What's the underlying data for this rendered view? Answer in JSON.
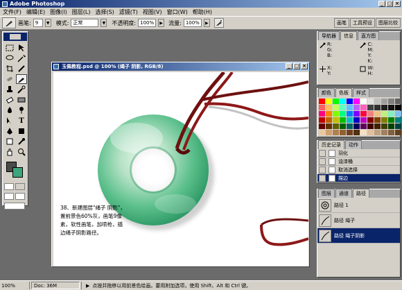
{
  "app": {
    "title": "Adobe Photoshop"
  },
  "menu": [
    "文件(F)",
    "编辑(E)",
    "图像(I)",
    "图层(L)",
    "选择(S)",
    "滤镜(T)",
    "视图(V)",
    "窗口(W)",
    "帮助(H)"
  ],
  "options": {
    "brush_label": "画笔:",
    "brush_size": "9",
    "mode_label": "模式:",
    "mode_value": "正常",
    "opacity_label": "不透明度:",
    "opacity_value": "100%",
    "flow_label": "流量:",
    "flow_value": "100%"
  },
  "palette_well": [
    "画笔",
    "工具预设",
    "图层比较"
  ],
  "document": {
    "title": "玉佩教程.psd @ 100% (绳子 阴影, RGB/8)",
    "caption": "38、新建图层\"绳子 阴影\"，置前景色60%灰，画笔9像素，软性画笔，加喷枪，描边绳子阴影路径。"
  },
  "navigator_panel": {
    "tabs": [
      "导航器",
      "信息",
      "直方图"
    ],
    "active_tab": 1,
    "cells": [
      {
        "icon": "eyedropper-icon",
        "labels": [
          "R:",
          "G:",
          "B:"
        ]
      },
      {
        "icon": "eyedropper-icon",
        "labels": [
          "C:",
          "M:",
          "Y:",
          "K:"
        ]
      },
      {
        "icon": "crosshair-icon",
        "labels": [
          "X:",
          "Y:"
        ]
      },
      {
        "icon": "rect-icon",
        "labels": [
          "W:",
          "H:"
        ]
      }
    ]
  },
  "color_panel": {
    "tabs": [
      "颜色",
      "色板",
      "样式"
    ],
    "active_tab": 1,
    "colors": [
      "#ff0000",
      "#ffff00",
      "#00ff00",
      "#00ffff",
      "#0000ff",
      "#ff00ff",
      "#ffffff",
      "#e0e0e0",
      "#c0c0c0",
      "#a0a0a0",
      "#808080",
      "#606060",
      "#ff6060",
      "#ffc060",
      "#c0ff60",
      "#60ffc0",
      "#60c0ff",
      "#c060ff",
      "#ff60c0",
      "#404040",
      "#303030",
      "#202020",
      "#101010",
      "#000000",
      "#ff0080",
      "#ff8000",
      "#80ff00",
      "#00ff80",
      "#0080ff",
      "#8000ff",
      "#ff0040",
      "#f08080",
      "#f0c080",
      "#c0f080",
      "#80f0c0",
      "#80c0f0",
      "#c00000",
      "#c06000",
      "#c0c000",
      "#00c000",
      "#00c0c0",
      "#0000c0",
      "#c000c0",
      "#800000",
      "#804000",
      "#808000",
      "#008000",
      "#008080",
      "#600000",
      "#603000",
      "#606000",
      "#006000",
      "#006060",
      "#000060",
      "#600060",
      "#400000",
      "#402000",
      "#404000",
      "#004000",
      "#004040",
      "#e8c8a0",
      "#d0a070",
      "#b08050",
      "#906030",
      "#704020",
      "#503010",
      "#f8e0c0",
      "#e0c0a0",
      "#c0a080",
      "#a08060",
      "#806040",
      "#604020"
    ]
  },
  "history_panel": {
    "tabs": [
      "历史记录",
      "动作"
    ],
    "active_tab": 0,
    "items": [
      {
        "label": "羽化",
        "selected": false
      },
      {
        "label": "油漆桶",
        "selected": false
      },
      {
        "label": "取消选择",
        "selected": false
      },
      {
        "label": "描边",
        "selected": true
      }
    ]
  },
  "paths_panel": {
    "tabs": [
      "图层",
      "通道",
      "路径"
    ],
    "active_tab": 2,
    "items": [
      {
        "label": "路径 1",
        "selected": false
      },
      {
        "label": "路径 绳子",
        "selected": false
      },
      {
        "label": "路径 绳子阴影",
        "selected": true
      }
    ]
  },
  "status": {
    "zoom": "100%",
    "doc_label": "Doc: 36M",
    "hint": "点按并拖移以用前景色绘画。要用附加选项，使用 Shift、Alt 和 Ctrl 键。"
  }
}
